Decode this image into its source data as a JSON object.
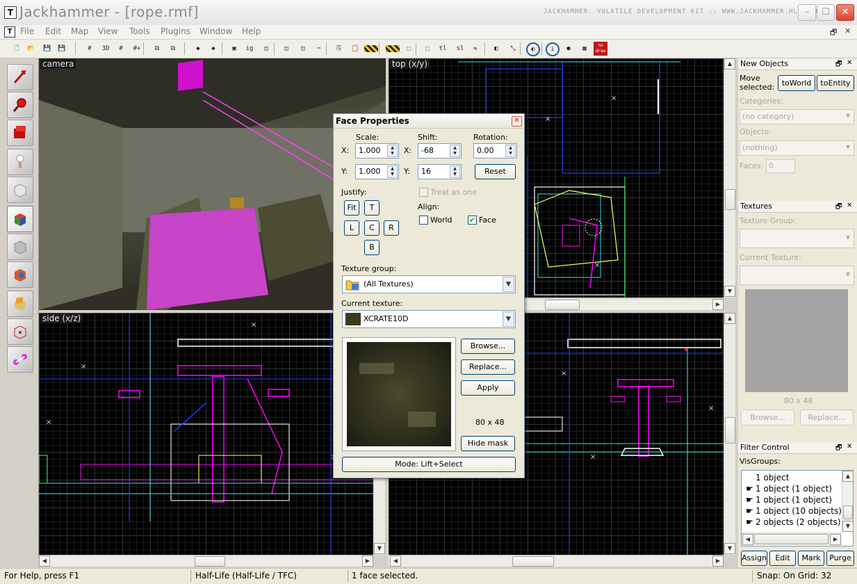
{
  "window": {
    "title": "Jackhammer - [rope.rmf]",
    "kit_label": "JACKHAMMER: VOLATILE DEVELOPMENT KIT :: WWW.JACKHAMMER.HLFX.RU",
    "logo": "T",
    "buttons": {
      "minimize": "–",
      "maximize": "☐",
      "close": "✕"
    }
  },
  "menu": {
    "items": [
      "File",
      "Edit",
      "Map",
      "View",
      "Tools",
      "Plugins",
      "Window",
      "Help"
    ],
    "mdi_restore": "🗗",
    "mdi_close": "✕"
  },
  "toolbar": {
    "buttons": [
      {
        "icon": "new-file-icon",
        "glyph": "🗋"
      },
      {
        "icon": "open-folder-icon",
        "glyph": "📂"
      },
      {
        "icon": "save-icon",
        "glyph": "💾"
      },
      {
        "icon": "save-as-icon",
        "glyph": "💾"
      },
      {
        "icon": "grid-icon",
        "glyph": "#"
      },
      {
        "icon": "3d-grid-icon",
        "glyph": "3D"
      },
      {
        "icon": "small-grid-icon",
        "glyph": "#"
      },
      {
        "icon": "grid-plus-icon",
        "glyph": "#+"
      },
      {
        "icon": "group-icon",
        "glyph": "⧉"
      },
      {
        "icon": "ungroup-icon",
        "glyph": "⧉"
      },
      {
        "icon": "paint-icon",
        "glyph": "◆"
      },
      {
        "icon": "texture-lock-icon",
        "glyph": "◆"
      },
      {
        "icon": "carve-icon",
        "glyph": "▣"
      },
      {
        "icon": "ignore-groups-icon",
        "glyph": "ig"
      },
      {
        "icon": "hollow-icon",
        "glyph": "◫"
      },
      {
        "icon": "clip-icon",
        "glyph": "◫"
      },
      {
        "icon": "cube-icon",
        "glyph": "◫"
      },
      {
        "icon": "cut-icon",
        "glyph": "✂"
      },
      {
        "icon": "copy-icon",
        "glyph": "⎘"
      },
      {
        "icon": "paste-icon",
        "glyph": "📋"
      },
      {
        "icon": "hazard-icon",
        "glyph": "▨"
      },
      {
        "icon": "hazard-select-icon",
        "glyph": "▨"
      },
      {
        "icon": "select-box-icon",
        "glyph": "⬚"
      },
      {
        "icon": "select-dashed-icon",
        "glyph": "⬚"
      },
      {
        "icon": "tl-icon",
        "glyph": "tl"
      },
      {
        "icon": "sl-icon",
        "glyph": "sl"
      },
      {
        "icon": "flip-icon",
        "glyph": "⇋"
      },
      {
        "icon": "align-icon",
        "glyph": "◧"
      },
      {
        "icon": "scale-icon",
        "glyph": "⤡"
      },
      {
        "icon": "sphere-icon",
        "glyph": "◐"
      },
      {
        "icon": "info-icon",
        "glyph": "i"
      },
      {
        "icon": "point-icon",
        "glyph": "●"
      },
      {
        "icon": "wireframe-icon",
        "glyph": "▦"
      },
      {
        "icon": "no-draw-icon",
        "glyph": "no draw"
      }
    ]
  },
  "tools": [
    "select-arrow-tool-icon",
    "magnify-tool-icon",
    "camera-tool-icon",
    "entity-tool-icon",
    "block-tool-icon",
    "texture-application-tool-icon",
    "apply-texture-tool-icon",
    "decal-tool-icon",
    "overlay-tool-icon",
    "clip-tool-icon",
    "vertex-tool-icon",
    "path-tool-icon"
  ],
  "viewports": {
    "camera": {
      "label": "camera"
    },
    "top": {
      "label": "top (x/y)"
    },
    "side": {
      "label": "side (x/z)"
    },
    "front": {
      "label": ""
    }
  },
  "face_properties": {
    "title": "Face Properties",
    "scale_label": "Scale:",
    "shift_label": "Shift:",
    "rotation_label": "Rotation:",
    "x_label": "X:",
    "y_label": "Y:",
    "scale_x": "1.000",
    "scale_y": "1.000",
    "shift_x": "-68",
    "shift_y": "16",
    "rotation": "0.00",
    "reset": "Reset",
    "justify_label": "Justify:",
    "justify": {
      "fit": "Fit",
      "t": "T",
      "l": "L",
      "c": "C",
      "r": "R",
      "b": "B"
    },
    "treat_as_one": "Treat as one",
    "treat_as_one_checked": false,
    "align_label": "Align:",
    "world": "World",
    "world_checked": false,
    "face": "Face",
    "face_checked": true,
    "texture_group_label": "Texture group:",
    "texture_group": "(All Textures)",
    "current_texture_label": "Current texture:",
    "current_texture": "XCRATE10D",
    "browse": "Browse...",
    "replace": "Replace...",
    "apply": "Apply",
    "tex_size": "80 x 48",
    "hide_mask": "Hide mask",
    "mode": "Mode: Lift+Select",
    "check_glyph": "✔"
  },
  "new_objects": {
    "title": "New Objects",
    "move_selected": "Move selected:",
    "to_world": "toWorld",
    "to_entity": "toEntity",
    "categories_label": "Categories:",
    "categories_value": "(no category)",
    "objects_label": "Objects:",
    "objects_value": "(nothing)",
    "faces_label": "Faces:",
    "faces_value": "0"
  },
  "textures_panel": {
    "title": "Textures",
    "texture_group_label": "Texture Group:",
    "current_texture_label": "Current Texture:",
    "size": "80 x 48",
    "browse": "Browse...",
    "replace": "Replace..."
  },
  "filter_control": {
    "title": "Filter Control",
    "visgroups_label": "VisGroups:",
    "items": [
      "1 object",
      "1 object (1 object)",
      "1 object (1 object)",
      "1 object (10 objects)",
      "2 objects (2 objects)"
    ],
    "buttons": {
      "assign": "Assign",
      "edit": "Edit",
      "mark": "Mark",
      "purge": "Purge"
    }
  },
  "panel_icons": {
    "restore": "🗗",
    "close": "✕"
  },
  "status": {
    "help": "For Help, press F1",
    "game": "Half-Life (Half-Life / TFC)",
    "selection": "1 face selected.",
    "snap": "Snap: On Grid: 32"
  },
  "colors": {
    "accent": "#d8452f",
    "wire_magenta": "#ff00ff",
    "wire_white": "#ffffff",
    "wire_blue": "#2040ff",
    "wire_cyan": "#40e0e0",
    "wire_yellow": "#ffff60",
    "wire_green": "#30ff60"
  }
}
